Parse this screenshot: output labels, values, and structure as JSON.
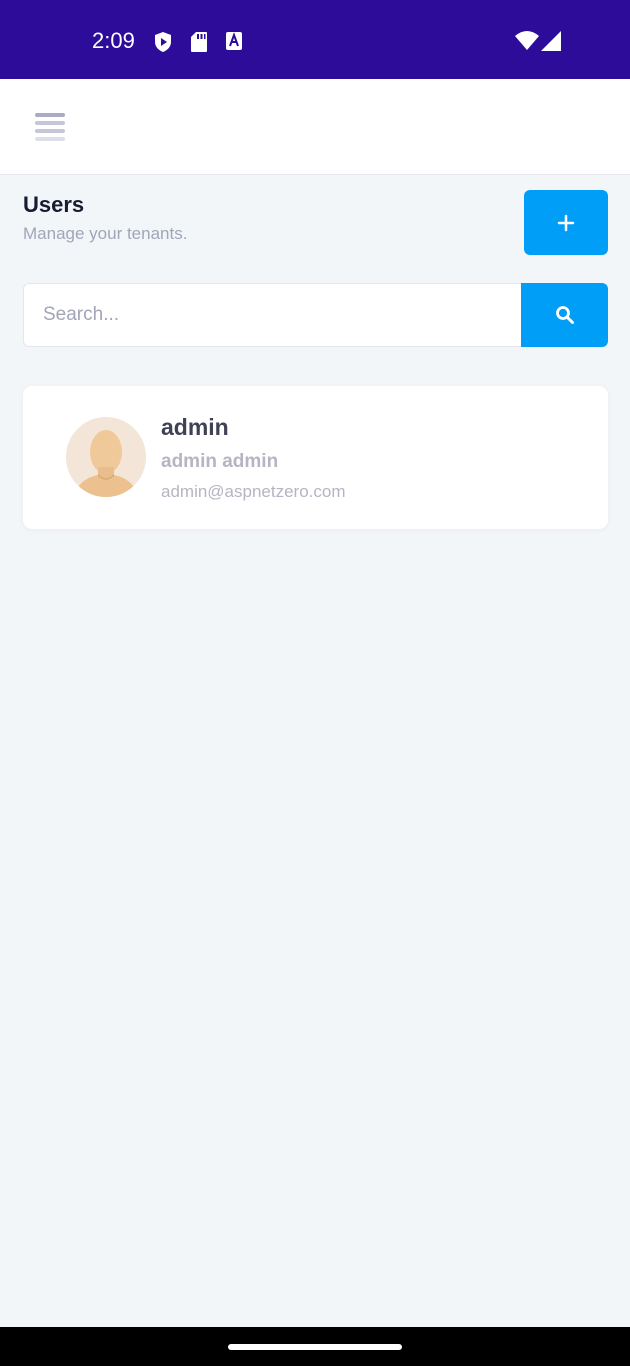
{
  "status_bar": {
    "time": "2:09",
    "icons": [
      "shield-play-icon",
      "sd-card-icon",
      "font-a-icon",
      "wifi-icon",
      "signal-icon"
    ]
  },
  "top_bar": {
    "menu_icon": "hamburger-menu-icon"
  },
  "page": {
    "title": "Users",
    "subtitle": "Manage your tenants.",
    "add_button_icon": "plus-icon"
  },
  "search": {
    "placeholder": "Search...",
    "value": "",
    "button_icon": "search-icon"
  },
  "users": [
    {
      "username": "admin",
      "full_name": "admin admin",
      "email": "admin@aspnetzero.com",
      "avatar_icon": "default-avatar-icon"
    }
  ],
  "colors": {
    "status_bar": "#2d0c9a",
    "primary": "#009ef7",
    "background": "#f3f6f9",
    "card": "#ffffff",
    "title": "#181c32",
    "muted": "#a1a5b7"
  }
}
